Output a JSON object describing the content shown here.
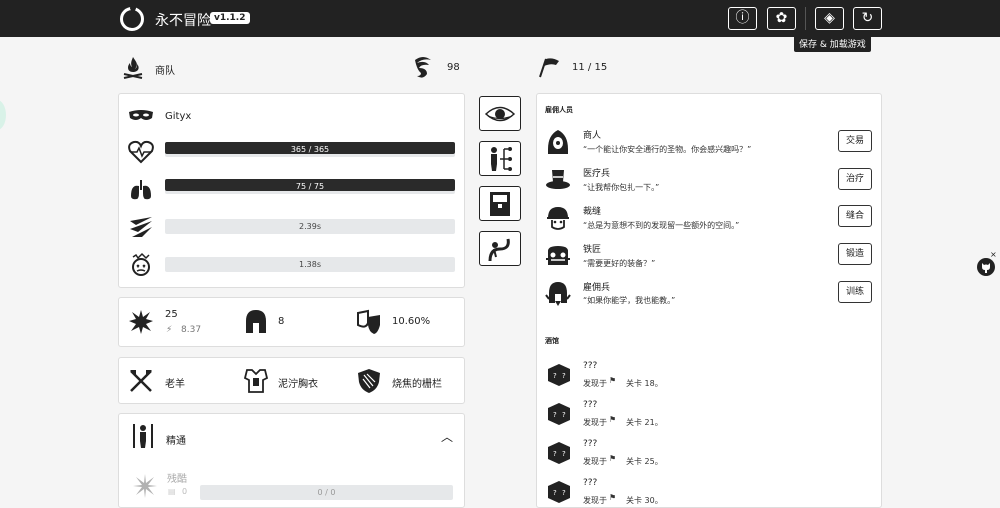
{
  "app": {
    "title": "永不冒险",
    "version": "v1.1.2"
  },
  "toolbar": {
    "info_icon": "ⓘ",
    "discord_icon": "✿",
    "save_icon": "◈",
    "restart_icon": "↻",
    "save_tooltip": "保存 & 加载游戏"
  },
  "header": {
    "caravan_label": "商队",
    "essence": "98",
    "stage": "11 / 15"
  },
  "character": {
    "name": "Gityx",
    "health": "365 / 365",
    "health_fill": 1.0,
    "stamina": "75 / 75",
    "stamina_fill": 1.0,
    "attack_rate": "2.39s",
    "deflect_rate": "1.38s"
  },
  "stats": {
    "damage": "25",
    "attack_speed": "8.37",
    "protection": "8",
    "deflection": "10.60%"
  },
  "gear": {
    "weapon": "老羊",
    "armor": "泥泞胸衣",
    "shield": "烧焦的栅栏"
  },
  "mastery": {
    "title": "精通",
    "skill": "残酷",
    "skill_points": "0",
    "skill_progress": "0 / 0"
  },
  "mercenaries": {
    "title": "雇佣人员",
    "items": [
      {
        "name": "商人",
        "quote": "“一个能让你安全通行的圣物。你会感兴趣吗？”",
        "action": "交易"
      },
      {
        "name": "医疗兵",
        "quote": "“让我帮你包扎一下。”",
        "action": "治疗"
      },
      {
        "name": "裁缝",
        "quote": "“总是为意想不到的发现留一些额外的空间。”",
        "action": "缝合"
      },
      {
        "name": "铁匠",
        "quote": "“需要更好的装备？”",
        "action": "锻造"
      },
      {
        "name": "雇佣兵",
        "quote": "“如果你能学，我也能教。”",
        "action": "训练"
      }
    ]
  },
  "tavern": {
    "title": "酒馆",
    "items": [
      {
        "name": "???",
        "found_at": "发现于",
        "stage": "关卡 18。"
      },
      {
        "name": "???",
        "found_at": "发现于",
        "stage": "关卡 21。"
      },
      {
        "name": "???",
        "found_at": "发现于",
        "stage": "关卡 25。"
      },
      {
        "name": "???",
        "found_at": "发现于",
        "stage": "关卡 30。"
      }
    ]
  }
}
